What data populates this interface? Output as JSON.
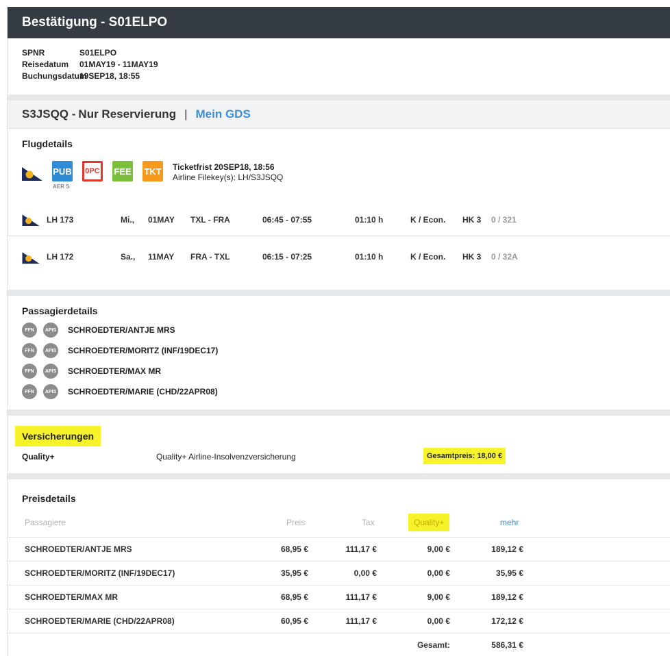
{
  "header": {
    "title": "Bestätigung - S01ELPO"
  },
  "summary": {
    "spnr_label": "SPNR",
    "spnr_value": "S01ELPO",
    "reisedatum_label": "Reisedatum",
    "reisedatum_value": "01MAY19 - 11MAY19",
    "buchungsdatum_label": "Buchungsdatum",
    "buchungsdatum_value": "19SEP18, 18:55"
  },
  "booking": {
    "code": "S3JSQQ - ",
    "type": "Nur Reservierung",
    "separator": "|",
    "gds_link": "Mein GDS"
  },
  "flugdetails": {
    "title": "Flugdetails",
    "badges": {
      "pub": "PUB",
      "opc": "0PC",
      "fee": "FEE",
      "tkt": "TKT",
      "aer": "AER S"
    },
    "ticketfrist": "Ticketfrist 20SEP18, 18:56",
    "filekey": "Airline Filekey(s): LH/S3JSQQ",
    "flights": [
      {
        "flight": "LH 173",
        "day": "Mi.,",
        "date": "01MAY",
        "route": "TXL - FRA",
        "time": "06:45 - 07:55",
        "duration": "01:10 h",
        "class": "K / Econ.",
        "status": "HK 3",
        "seat": "0 / 321"
      },
      {
        "flight": "LH 172",
        "day": "Sa.,",
        "date": "11MAY",
        "route": "FRA - TXL",
        "time": "06:15 - 07:25",
        "duration": "01:10 h",
        "class": "K / Econ.",
        "status": "HK 3",
        "seat": "0 / 32A"
      }
    ]
  },
  "passagiere": {
    "title": "Passagierdetails",
    "ffn": "FFN",
    "apis": "APIS",
    "list": [
      "SCHROEDTER/ANTJE MRS",
      "SCHROEDTER/MORITZ  (INF/19DEC17)",
      "SCHROEDTER/MAX MR",
      "SCHROEDTER/MARIE  (CHD/22APR08)"
    ]
  },
  "versicherung": {
    "title": "Versicherungen",
    "name": "Quality+",
    "description": "Quality+ Airline-Insolvenzversicherung",
    "gesamtpreis": "Gesamtpreis: 18,00 €"
  },
  "preisdetails": {
    "title": "Preisdetails",
    "headers": {
      "passagiere": "Passagiere",
      "preis": "Preis",
      "tax": "Tax",
      "quality": "Quality+",
      "mehr": "mehr"
    },
    "rows": [
      {
        "name": "SCHROEDTER/ANTJE MRS",
        "preis": "68,95 €",
        "tax": "111,17 €",
        "quality": "9,00 €",
        "total": "189,12 €"
      },
      {
        "name": "SCHROEDTER/MORITZ (INF/19DEC17)",
        "preis": "35,95 €",
        "tax": "0,00 €",
        "quality": "0,00 €",
        "total": "35,95 €"
      },
      {
        "name": "SCHROEDTER/MAX MR",
        "preis": "68,95 €",
        "tax": "111,17 €",
        "quality": "9,00 €",
        "total": "189,12 €"
      },
      {
        "name": "SCHROEDTER/MARIE (CHD/22APR08)",
        "preis": "60,95 €",
        "tax": "111,17 €",
        "quality": "0,00 €",
        "total": "172,12 €"
      }
    ],
    "gesamt_label": "Gesamt:",
    "gesamt_value": "586,31 €"
  },
  "colors": {
    "titlebar": "#343b42",
    "link": "#3b8fd8",
    "highlight": "#f6f32a",
    "pub": "#2e8bd6",
    "opc": "#e0392b",
    "fee": "#7cbf3c",
    "tkt": "#f59a1c"
  },
  "icons": {
    "airline": "lufthansa-tail-icon"
  }
}
